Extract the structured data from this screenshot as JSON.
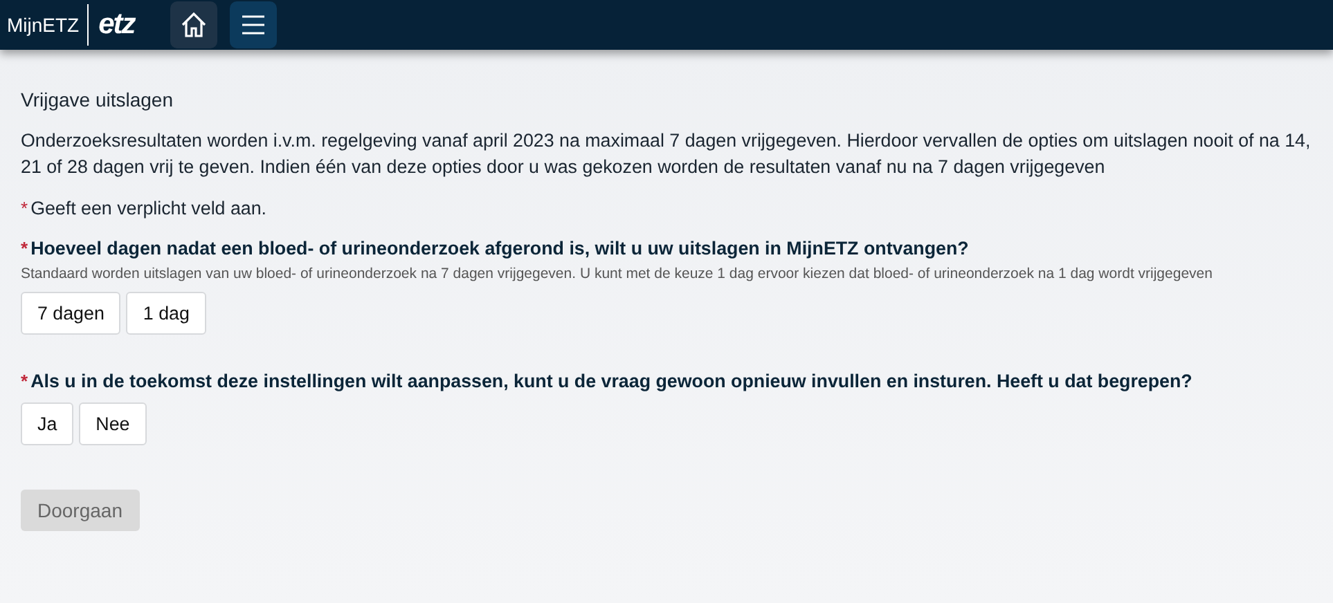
{
  "header": {
    "brand": "MijnETZ",
    "logo": "etz",
    "nav": [
      {
        "kind": "home",
        "selected": false
      },
      {
        "kind": "menu",
        "selected": true
      }
    ]
  },
  "page": {
    "title": "Vrijgave uitslagen",
    "intro": "Onderzoeksresultaten worden i.v.m. regelgeving vanaf april 2023 na maximaal 7 dagen vrijgegeven. Hierdoor vervallen de opties om uitslagen nooit of na 14, 21 of 28 dagen vrij te geven. Indien één van deze opties door u was gekozen worden de resultaten vanaf nu na 7 dagen vrijgegeven",
    "required_mark": "*",
    "required_note": "Geeft een verplicht veld aan."
  },
  "questions": [
    {
      "required": true,
      "label": "Hoeveel dagen nadat een bloed- of urineonderzoek afgerond is, wilt u uw uitslagen in MijnETZ ontvangen?",
      "help": "Standaard worden uitslagen van uw bloed- of urineonderzoek na 7 dagen vrijgegeven. U kunt met de keuze 1 dag ervoor kiezen dat bloed- of urineonderzoek na 1 dag wordt vrijgegeven",
      "options": [
        {
          "label": "7 dagen",
          "selected": false
        },
        {
          "label": "1 dag",
          "selected": false
        }
      ]
    },
    {
      "required": true,
      "label": "Als u in de toekomst deze instellingen wilt aanpassen, kunt u de vraag gewoon opnieuw invullen en insturen. Heeft u dat begrepen?",
      "options": [
        {
          "label": "Ja",
          "selected": false
        },
        {
          "label": "Nee",
          "selected": false
        }
      ]
    }
  ],
  "submit": {
    "label": "Doorgaan",
    "disabled": true
  }
}
